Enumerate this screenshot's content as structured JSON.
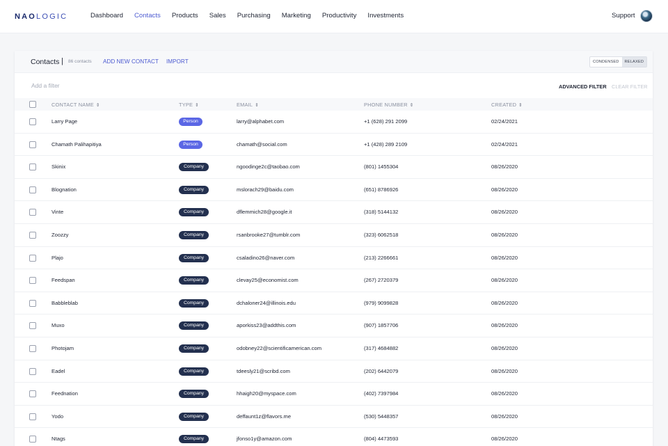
{
  "brand": {
    "name_bold": "NAO",
    "name_light": "LOGIC"
  },
  "nav": [
    "Dashboard",
    "Contacts",
    "Products",
    "Sales",
    "Purchasing",
    "Marketing",
    "Productivity",
    "Investments"
  ],
  "nav_active": "Contacts",
  "support_label": "Support",
  "header": {
    "title": "Contacts",
    "separator": "|",
    "count": "86 contacts",
    "add_label": "ADD NEW CONTACT",
    "import_label": "IMPORT",
    "density_condensed": "CONDENSED",
    "density_relaxed": "RELAXED"
  },
  "filter": {
    "placeholder": "Add a filter",
    "advanced_label": "ADVANCED FILTER",
    "clear_label": "CLEAR FILTER"
  },
  "columns": {
    "name": "CONTACT NAME",
    "type": "TYPE",
    "email": "EMAIL",
    "phone": "PHONE NUMBER",
    "created": "CREATED",
    "sort_glyph": "⇕"
  },
  "colors": {
    "accent": "#4d5bd1",
    "company_badge": "#23304f",
    "person_badge": "#5b67e5"
  },
  "rows": [
    {
      "name": "Larry Page",
      "type": "Person",
      "email": "larry@alphabet.com",
      "phone": "+1 (628) 291 2099",
      "created": "02/24/2021"
    },
    {
      "name": "Chamath Palihapitiya",
      "type": "Person",
      "email": "chamath@social.com",
      "phone": "+1 (428) 289 2109",
      "created": "02/24/2021"
    },
    {
      "name": "Skinix",
      "type": "Company",
      "email": "ngoodinge2c@taobao.com",
      "phone": "(801) 1455304",
      "created": "08/26/2020"
    },
    {
      "name": "Blognation",
      "type": "Company",
      "email": "mslorach29@baidu.com",
      "phone": "(651) 8786926",
      "created": "08/26/2020"
    },
    {
      "name": "Vinte",
      "type": "Company",
      "email": "dflemmich28@google.it",
      "phone": "(318) 5144132",
      "created": "08/26/2020"
    },
    {
      "name": "Zoozzy",
      "type": "Company",
      "email": "rsanbrooke27@tumblr.com",
      "phone": "(323) 6062518",
      "created": "08/26/2020"
    },
    {
      "name": "Plajo",
      "type": "Company",
      "email": "csaladino26@naver.com",
      "phone": "(213) 2266661",
      "created": "08/26/2020"
    },
    {
      "name": "Feedspan",
      "type": "Company",
      "email": "clevay25@economist.com",
      "phone": "(267) 2720379",
      "created": "08/26/2020"
    },
    {
      "name": "Babbleblab",
      "type": "Company",
      "email": "dchaloner24@illinois.edu",
      "phone": "(979) 9099828",
      "created": "08/26/2020"
    },
    {
      "name": "Muxo",
      "type": "Company",
      "email": "aporkiss23@addthis.com",
      "phone": "(907) 1857706",
      "created": "08/26/2020"
    },
    {
      "name": "Photojam",
      "type": "Company",
      "email": "odobney22@scientificamerican.com",
      "phone": "(317) 4684882",
      "created": "08/26/2020"
    },
    {
      "name": "Eadel",
      "type": "Company",
      "email": "tdeesly21@scribd.com",
      "phone": "(202) 6442079",
      "created": "08/26/2020"
    },
    {
      "name": "Feednation",
      "type": "Company",
      "email": "hhaigh20@myspace.com",
      "phone": "(402) 7397984",
      "created": "08/26/2020"
    },
    {
      "name": "Yodo",
      "type": "Company",
      "email": "deffaunt1z@flavors.me",
      "phone": "(530) 5448357",
      "created": "08/26/2020"
    },
    {
      "name": "Ntags",
      "type": "Company",
      "email": "jfonso1y@amazon.com",
      "phone": "(804) 4473593",
      "created": "08/26/2020"
    }
  ]
}
